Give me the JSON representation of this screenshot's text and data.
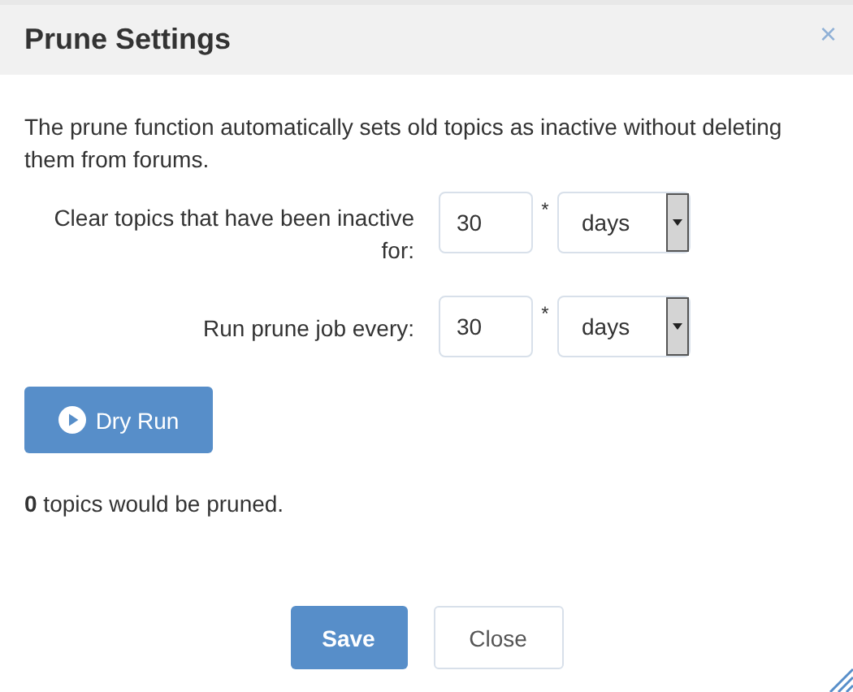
{
  "dialog": {
    "title": "Prune Settings",
    "close": "×"
  },
  "description": "The prune function automatically sets old topics as inactive without deleting them from forums.",
  "fields": [
    {
      "label": "Clear topics that have been inactive for:",
      "value": "30",
      "multiplier": "*",
      "unit": "days"
    },
    {
      "label": "Run prune job every:",
      "value": "30",
      "multiplier": "*",
      "unit": "days"
    }
  ],
  "dry_run_button": "Dry Run",
  "result": "**0** topics would be pruned.",
  "buttons": [
    {
      "label": "Save",
      "kind": "primary"
    },
    {
      "label": "Close",
      "kind": "default"
    }
  ]
}
